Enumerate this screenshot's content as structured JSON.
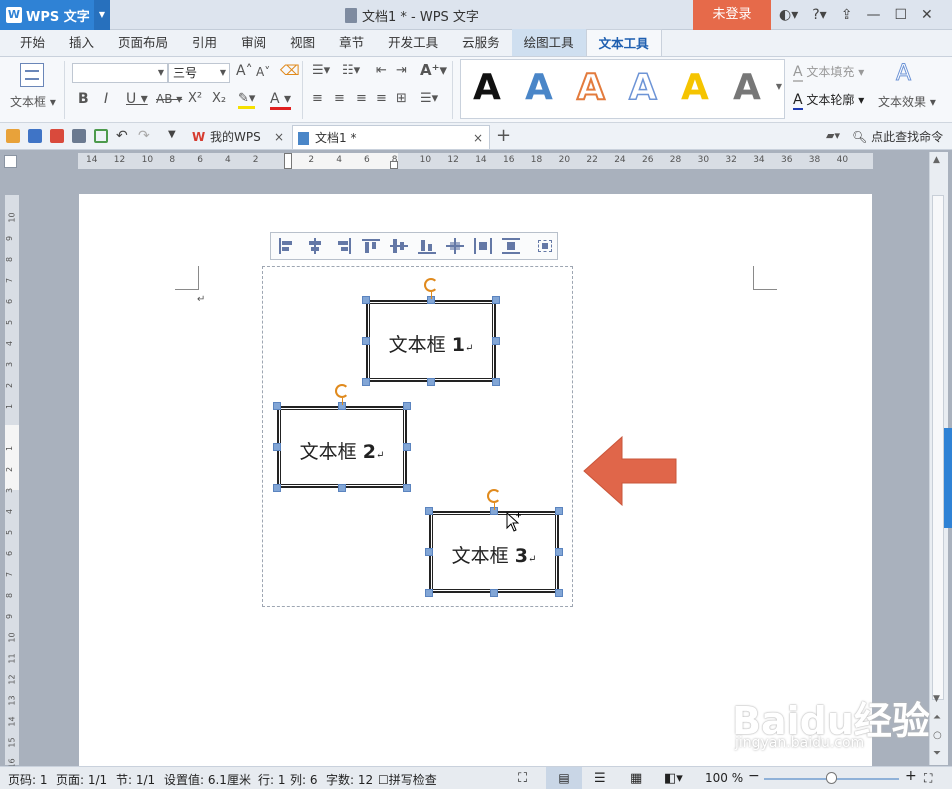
{
  "app": {
    "name": "WPS 文字",
    "title": "文档1 * - WPS 文字",
    "login": "未登录"
  },
  "menu": [
    "开始",
    "插入",
    "页面布局",
    "引用",
    "审阅",
    "视图",
    "章节",
    "开发工具",
    "云服务",
    "绘图工具",
    "文本工具"
  ],
  "ribbon": {
    "textbox_label": "文本框",
    "font_size": "三号",
    "text_fill": "文本填充",
    "text_outline": "文本轮廓",
    "text_effect": "文本效果",
    "style_colors": [
      "#111111",
      "#4a86c8",
      "#e37b3d",
      "#8faee0",
      "#f5c400",
      "#777777"
    ]
  },
  "tabs": {
    "mywps": "我的WPS",
    "doc": "文档1 *",
    "search": "点此查找命令"
  },
  "ruler_h": [
    "14",
    "12",
    "10",
    "8",
    "6",
    "4",
    "2",
    "",
    "2",
    "4",
    "6",
    "8",
    "10",
    "12",
    "14",
    "16",
    "18",
    "20",
    "22",
    "24",
    "26",
    "28",
    "30",
    "32",
    "34",
    "36",
    "38",
    "40"
  ],
  "ruler_v": [
    "10",
    "9",
    "8",
    "7",
    "6",
    "5",
    "4",
    "3",
    "2",
    "1",
    "",
    "1",
    "2",
    "3",
    "4",
    "5",
    "6",
    "7",
    "8",
    "9",
    "10",
    "11",
    "12",
    "13",
    "14",
    "15",
    "16"
  ],
  "textboxes": [
    {
      "label": "文本框 ",
      "num": "1"
    },
    {
      "label": "文本框 ",
      "num": "2"
    },
    {
      "label": "文本框 ",
      "num": "3"
    }
  ],
  "paragraph_mark": "↵",
  "status": {
    "page": "页码: 1",
    "pages": "页面: 1/1",
    "section": "节: 1/1",
    "setting": "设置值: 6.1厘米",
    "row": "行: 1",
    "col": "列: 6",
    "chars": "字数: 12",
    "spell": "拼写检查",
    "zoom": "100 %"
  },
  "arrow_color": "#e0664a",
  "watermark": {
    "brand": "Baidu经验",
    "url": "jingyan.baidu.com"
  }
}
